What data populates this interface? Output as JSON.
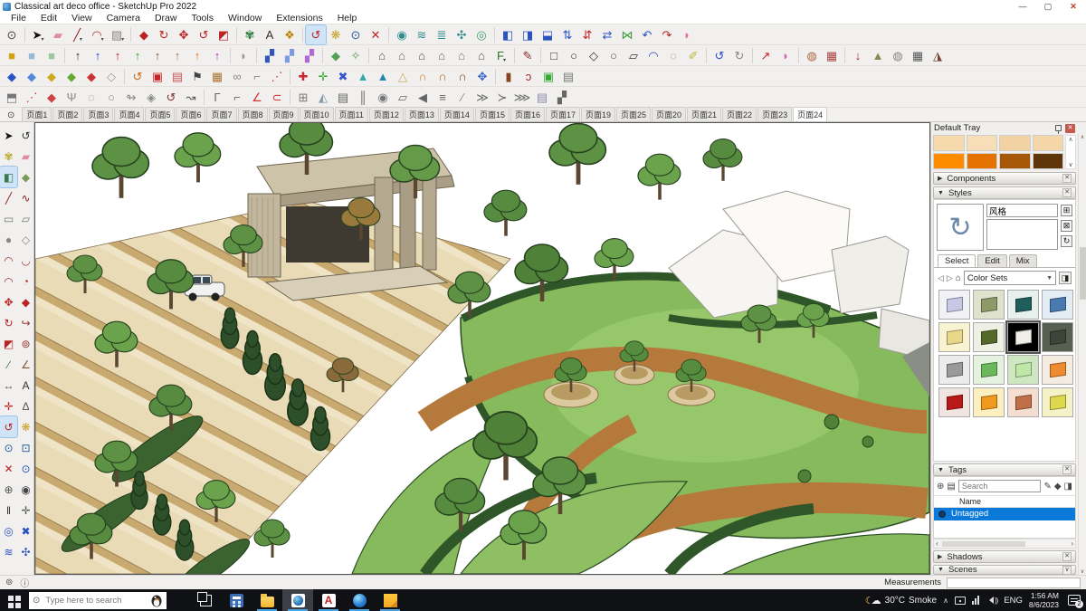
{
  "window": {
    "title": "Classical art deco office - SketchUp Pro 2022",
    "controls": {
      "minimize": "—",
      "maximize": "▢",
      "close": "✕"
    }
  },
  "menubar": [
    "File",
    "Edit",
    "View",
    "Camera",
    "Draw",
    "Tools",
    "Window",
    "Extensions",
    "Help"
  ],
  "toolbars": {
    "row1": [
      {
        "n": "zoom-tool",
        "g": "⊙",
        "c": "#444"
      },
      {
        "sep": 1
      },
      {
        "n": "select",
        "g": "➤",
        "c": "#111",
        "dd": 1
      },
      {
        "n": "eraser",
        "g": "▰",
        "c": "#e08ba0"
      },
      {
        "n": "line",
        "g": "╱",
        "c": "#8a1a1a",
        "dd": 1
      },
      {
        "n": "arc",
        "g": "◠",
        "c": "#a33",
        "dd": 1
      },
      {
        "n": "rectangle",
        "g": "▨",
        "c": "#8a8a8a",
        "dd": 1
      },
      {
        "sep": 1
      },
      {
        "n": "push-pull",
        "g": "◆",
        "c": "#b22"
      },
      {
        "n": "follow-me",
        "g": "↻",
        "c": "#b22"
      },
      {
        "n": "move",
        "g": "✥",
        "c": "#b22"
      },
      {
        "n": "rotate",
        "g": "↺",
        "c": "#b22"
      },
      {
        "n": "scale",
        "g": "◩",
        "c": "#b22"
      },
      {
        "sep": 1
      },
      {
        "n": "paint-bucket",
        "g": "✾",
        "c": "#2a7a3a"
      },
      {
        "n": "text",
        "g": "A",
        "c": "#333"
      },
      {
        "n": "match-photo",
        "g": "❖",
        "c": "#b8860b"
      },
      {
        "sep": 1
      },
      {
        "n": "orbit",
        "g": "↺",
        "c": "#b22",
        "sel": 1
      },
      {
        "n": "pan",
        "g": "❋",
        "c": "#c9a227"
      },
      {
        "n": "zoom",
        "g": "⊙",
        "c": "#235a9e"
      },
      {
        "n": "zoom-extents",
        "g": "✕",
        "c": "#b22"
      },
      {
        "sep": 1
      },
      {
        "n": "section-plane",
        "g": "◉",
        "c": "#2e8b8b"
      },
      {
        "n": "section-display",
        "g": "≋",
        "c": "#2e8b8b"
      },
      {
        "n": "section-cuts",
        "g": "≣",
        "c": "#2e8b8b"
      },
      {
        "n": "section-fill",
        "g": "✣",
        "c": "#2e8b8b"
      },
      {
        "n": "add-location",
        "g": "◎",
        "c": "#3aa06a"
      },
      {
        "sep": 1
      },
      {
        "n": "solid-union",
        "g": "◧",
        "c": "#2a52be"
      },
      {
        "n": "solid-subtract",
        "g": "◨",
        "c": "#2a52be"
      },
      {
        "n": "solid-trim",
        "g": "⬓",
        "c": "#2a52be"
      },
      {
        "n": "raise-object",
        "g": "⇅",
        "c": "#2a52be"
      },
      {
        "n": "drop-object",
        "g": "⇵",
        "c": "#b22"
      },
      {
        "n": "swap-axes",
        "g": "⇄",
        "c": "#2a52be"
      },
      {
        "n": "mirror",
        "g": "⋈",
        "c": "#3a9a3a"
      },
      {
        "n": "undo-curve",
        "g": "↶",
        "c": "#2a52be"
      },
      {
        "n": "redo-curve",
        "g": "↷",
        "c": "#b22"
      },
      {
        "n": "extrude-edges",
        "g": "◗",
        "c": "#e070a0"
      }
    ],
    "row2": [
      {
        "n": "box-ocher",
        "g": "■",
        "c": "#d4a017"
      },
      {
        "n": "box-blue",
        "g": "■",
        "c": "#9ab7d3"
      },
      {
        "n": "box-green",
        "g": "■",
        "c": "#9ec79e"
      },
      {
        "sep": 1
      },
      {
        "n": "drop-black",
        "g": "↑",
        "c": "#333"
      },
      {
        "n": "drop-blue",
        "g": "↑",
        "c": "#2244cc"
      },
      {
        "n": "drop-red",
        "g": "↑",
        "c": "#cc2222"
      },
      {
        "n": "drop-green",
        "g": "↑",
        "c": "#22aa22"
      },
      {
        "n": "drop-brown",
        "g": "↑",
        "c": "#775533"
      },
      {
        "n": "drop-tan",
        "g": "↑",
        "c": "#aa7744"
      },
      {
        "n": "drop-orange",
        "g": "↑",
        "c": "#dd7711"
      },
      {
        "n": "drop-magenta",
        "g": "↑",
        "c": "#cc22cc"
      },
      {
        "sep": 1
      },
      {
        "n": "shell",
        "g": "◗",
        "c": "#999"
      },
      {
        "sep": 1
      },
      {
        "n": "panel-1",
        "g": "▞",
        "c": "#3355bb"
      },
      {
        "n": "panel-2",
        "g": "▞",
        "c": "#7d9be0"
      },
      {
        "n": "panel-3",
        "g": "▞",
        "c": "#b06ad1"
      },
      {
        "sep": 1
      },
      {
        "n": "vegetation",
        "g": "◆",
        "c": "#55a055"
      },
      {
        "n": "skeleton",
        "g": "✧",
        "c": "#55a055"
      },
      {
        "sep": 1
      },
      {
        "n": "house-chimney",
        "g": "⌂",
        "c": "#555"
      },
      {
        "n": "house-tall",
        "g": "⌂",
        "c": "#666"
      },
      {
        "n": "house-plain",
        "g": "⌂",
        "c": "#555"
      },
      {
        "n": "house-flat",
        "g": "⌂",
        "c": "#666"
      },
      {
        "n": "house-outline",
        "g": "⌂",
        "c": "#777"
      },
      {
        "n": "house-roof",
        "g": "⌂",
        "c": "#555"
      },
      {
        "n": "fredo-scale",
        "g": "F",
        "c": "#2a7a2a",
        "dd": 1
      },
      {
        "sep": 1
      },
      {
        "n": "sketch-pencil",
        "g": "✎",
        "c": "#8a2a2a"
      },
      {
        "sep": 1
      },
      {
        "n": "shape-square",
        "g": "□",
        "c": "#333"
      },
      {
        "n": "shape-circle",
        "g": "○",
        "c": "#333"
      },
      {
        "n": "shape-polygon",
        "g": "◇",
        "c": "#333"
      },
      {
        "n": "shape-ellipse",
        "g": "○",
        "c": "#555"
      },
      {
        "n": "shape-parallelogram",
        "g": "▱",
        "c": "#333"
      },
      {
        "n": "shape-arc",
        "g": "◠",
        "c": "#2a52be"
      },
      {
        "n": "shape-ring",
        "g": "◌",
        "c": "#888"
      },
      {
        "n": "shape-marker",
        "g": "✐",
        "c": "#b8b83a"
      },
      {
        "sep": 1
      },
      {
        "n": "loop-blue",
        "g": "↺",
        "c": "#2a52be"
      },
      {
        "n": "loop-gray",
        "g": "↻",
        "c": "#888"
      },
      {
        "sep": 1
      },
      {
        "n": "vector-red",
        "g": "↗",
        "c": "#cc2222"
      },
      {
        "n": "vector-pink",
        "g": "◗",
        "c": "#dd66aa"
      },
      {
        "sep": 1
      },
      {
        "n": "mesh-dome",
        "g": "◍",
        "c": "#aa6644"
      },
      {
        "n": "mesh-grid",
        "g": "▦",
        "c": "#aa4444"
      },
      {
        "sep": 1
      },
      {
        "n": "stamp-down",
        "g": "↓",
        "c": "#aa2222"
      },
      {
        "n": "stamp-peak",
        "g": "▲",
        "c": "#888855"
      },
      {
        "n": "stamp-bag",
        "g": "◍",
        "c": "#888"
      },
      {
        "n": "stamp-dark",
        "g": "▦",
        "c": "#555"
      },
      {
        "n": "stamp-cone",
        "g": "◮",
        "c": "#774433"
      }
    ],
    "row3": [
      {
        "n": "gem-blue",
        "g": "◆",
        "c": "#2853c4"
      },
      {
        "n": "gem-skyblue",
        "g": "◆",
        "c": "#5588dd"
      },
      {
        "n": "gem-yellow",
        "g": "◆",
        "c": "#ccaa22"
      },
      {
        "n": "gem-green",
        "g": "◆",
        "c": "#66aa33"
      },
      {
        "n": "gem-red",
        "g": "◆",
        "c": "#cc3333"
      },
      {
        "n": "gem-outline",
        "g": "◇",
        "c": "#999"
      },
      {
        "sep": 1
      },
      {
        "n": "spiral-orange",
        "g": "↺",
        "c": "#cc6611"
      },
      {
        "n": "red-panel",
        "g": "▣",
        "c": "#cc2222"
      },
      {
        "n": "striped-panel",
        "g": "▤",
        "c": "#cc5555"
      },
      {
        "n": "flag",
        "g": "⚑",
        "c": "#444"
      },
      {
        "n": "wood-block",
        "g": "▦",
        "c": "#aa7733"
      },
      {
        "n": "link-pair",
        "g": "∞",
        "c": "#888"
      },
      {
        "n": "corner-tool",
        "g": "⌐",
        "c": "#888"
      },
      {
        "n": "path-dots",
        "g": "⋰",
        "c": "#cc3333"
      },
      {
        "sep": 1
      },
      {
        "n": "plus-red",
        "g": "✚",
        "c": "#cc2233"
      },
      {
        "n": "plus-green",
        "g": "✛",
        "c": "#33aa33"
      },
      {
        "n": "x-blue",
        "g": "✖",
        "c": "#3355cc"
      },
      {
        "n": "drop-teal",
        "g": "▲",
        "c": "#33aaaa"
      },
      {
        "n": "drop-teal-2",
        "g": "▲",
        "c": "#2288aa"
      },
      {
        "n": "cone-tan",
        "g": "△",
        "c": "#ccaa55"
      },
      {
        "n": "arch-orange",
        "g": "∩",
        "c": "#cc8833"
      },
      {
        "n": "arch-rust",
        "g": "∩",
        "c": "#aa6622"
      },
      {
        "n": "arch-brown",
        "g": "∩",
        "c": "#884411"
      },
      {
        "n": "compass-blue",
        "g": "✥",
        "c": "#3366cc"
      },
      {
        "sep": 1
      },
      {
        "n": "barrel",
        "g": "▮",
        "c": "#884422"
      },
      {
        "n": "hook-red",
        "g": "ↄ",
        "c": "#aa2222"
      },
      {
        "n": "green-board",
        "g": "▣",
        "c": "#33aa33"
      },
      {
        "n": "paste-board",
        "g": "▤",
        "c": "#777"
      }
    ],
    "row4": [
      {
        "n": "page-flip",
        "g": "⬒",
        "c": "#777"
      },
      {
        "n": "dots-path",
        "g": "⋰",
        "c": "#cc3333"
      },
      {
        "n": "claw",
        "g": "◆",
        "c": "#cc4444"
      },
      {
        "n": "fork",
        "g": "Ψ",
        "c": "#888"
      },
      {
        "n": "ring",
        "g": "◌",
        "c": "#888"
      },
      {
        "n": "blob",
        "g": "○",
        "c": "#888"
      },
      {
        "n": "swirl",
        "g": "↬",
        "c": "#888"
      },
      {
        "n": "gem-gray",
        "g": "◈",
        "c": "#888"
      },
      {
        "n": "knot",
        "g": "↺",
        "c": "#883333"
      },
      {
        "n": "lasso",
        "g": "↝",
        "c": "#555"
      },
      {
        "sep": 1
      },
      {
        "n": "corner-left",
        "g": "Γ",
        "c": "#666"
      },
      {
        "n": "corner-right",
        "g": "⌐",
        "c": "#666"
      },
      {
        "n": "angle-red",
        "g": "∠",
        "c": "#cc3333"
      },
      {
        "n": "curve-red",
        "g": "⊂",
        "c": "#cc3333"
      },
      {
        "sep": 1
      },
      {
        "n": "cage-grid",
        "g": "⊞",
        "c": "#777"
      },
      {
        "n": "prism",
        "g": "◭",
        "c": "#8899aa"
      },
      {
        "n": "louvers",
        "g": "▤",
        "c": "#666"
      },
      {
        "n": "fence",
        "g": "║",
        "c": "#666"
      },
      {
        "n": "grip",
        "g": "◉",
        "c": "#777"
      },
      {
        "n": "panel-flip",
        "g": "▱",
        "c": "#666"
      },
      {
        "n": "speaker-flag",
        "g": "◀",
        "c": "#666"
      },
      {
        "n": "list-lines",
        "g": "≡",
        "c": "#666"
      },
      {
        "n": "ramp",
        "g": "∕",
        "c": "#888"
      },
      {
        "n": "chevrons-1",
        "g": "≫",
        "c": "#666"
      },
      {
        "n": "chevrons-2",
        "g": "≻",
        "c": "#666"
      },
      {
        "n": "chevrons-3",
        "g": "⋙",
        "c": "#666"
      },
      {
        "n": "doc-gray",
        "g": "▤",
        "c": "#8888aa"
      },
      {
        "n": "hatch",
        "g": "▞",
        "c": "#666"
      }
    ]
  },
  "scene_tabs": {
    "search_icon": "⊙",
    "labels": [
      "页面1",
      "页面2",
      "页面3",
      "页面4",
      "页面5",
      "页面6",
      "页面7",
      "页面8",
      "页面9",
      "页面10",
      "页面11",
      "页面12",
      "页面13",
      "页面14",
      "页面15",
      "页面16",
      "页面17",
      "页面19",
      "页面25",
      "页面20",
      "页面21",
      "页面22",
      "页面23",
      "页面24"
    ],
    "selected_index": 23
  },
  "left_toolbar": [
    {
      "n": "select",
      "g": "➤",
      "c": "#111"
    },
    {
      "n": "orbit-select",
      "g": "↺",
      "c": "#333"
    },
    {
      "n": "paint",
      "g": "✾",
      "c": "#b8a832"
    },
    {
      "n": "eraser",
      "g": "▰",
      "c": "#e08ba0"
    },
    {
      "n": "component-box",
      "g": "◧",
      "c": "#3a7a4a",
      "sel": 1
    },
    {
      "n": "stamp",
      "g": "◆",
      "c": "#7a9a5a"
    },
    {
      "n": "line",
      "g": "╱",
      "c": "#8a1a1a"
    },
    {
      "n": "freehand",
      "g": "∿",
      "c": "#8a1a1a"
    },
    {
      "n": "rectangle",
      "g": "▭",
      "c": "#777"
    },
    {
      "n": "rotated-rectangle",
      "g": "▱",
      "c": "#777"
    },
    {
      "n": "circle",
      "g": "●",
      "c": "#888"
    },
    {
      "n": "polygon",
      "g": "◇",
      "c": "#888"
    },
    {
      "n": "arc",
      "g": "◠",
      "c": "#a33"
    },
    {
      "n": "two-point-arc",
      "g": "◡",
      "c": "#a33"
    },
    {
      "n": "three-point-arc",
      "g": "◠",
      "c": "#933"
    },
    {
      "n": "pie",
      "g": "◔",
      "c": "#a33"
    },
    {
      "n": "move",
      "g": "✥",
      "c": "#b22"
    },
    {
      "n": "push-pull",
      "g": "◆",
      "c": "#b22"
    },
    {
      "n": "rotate",
      "g": "↻",
      "c": "#b22"
    },
    {
      "n": "follow-me",
      "g": "↪",
      "c": "#933"
    },
    {
      "n": "scale",
      "g": "◩",
      "c": "#b22"
    },
    {
      "n": "offset",
      "g": "⊚",
      "c": "#933"
    },
    {
      "n": "tape-measure",
      "g": "∕",
      "c": "#2a7a3a"
    },
    {
      "n": "protractor",
      "g": "∠",
      "c": "#885533"
    },
    {
      "n": "dimension",
      "g": "↔",
      "c": "#555"
    },
    {
      "n": "text",
      "g": "A",
      "c": "#333"
    },
    {
      "n": "axes",
      "g": "✛",
      "c": "#b22"
    },
    {
      "n": "three-d-text",
      "g": "Δ",
      "c": "#555"
    },
    {
      "n": "orbit",
      "g": "↺",
      "c": "#b22",
      "sel": 1
    },
    {
      "n": "pan",
      "g": "❋",
      "c": "#c9a227"
    },
    {
      "n": "zoom",
      "g": "⊙",
      "c": "#235a9e"
    },
    {
      "n": "zoom-window",
      "g": "⊡",
      "c": "#235a9e"
    },
    {
      "n": "zoom-extents",
      "g": "✕",
      "c": "#b22"
    },
    {
      "n": "zoom-previous",
      "g": "⊙",
      "c": "#2a52be"
    },
    {
      "n": "position-camera",
      "g": "⊕",
      "c": "#555"
    },
    {
      "n": "look-around",
      "g": "◉",
      "c": "#444"
    },
    {
      "n": "walk",
      "g": "‖",
      "c": "#333"
    },
    {
      "n": "turn-target",
      "g": "✛",
      "c": "#555"
    },
    {
      "n": "section-plane",
      "g": "◎",
      "c": "#2a52be"
    },
    {
      "n": "section-x",
      "g": "✖",
      "c": "#2a52be"
    },
    {
      "n": "section-fill",
      "g": "≋",
      "c": "#2a52be"
    },
    {
      "n": "section-cut",
      "g": "✣",
      "c": "#2a52be"
    }
  ],
  "tray": {
    "title": "Default Tray",
    "palette": {
      "row1": [
        "#f6d9ad",
        "#f8deb6",
        "#f3d2a2",
        "#f5d6a8"
      ],
      "row2": [
        "#ff8c00",
        "#e37200",
        "#a65708",
        "#5e3509"
      ]
    },
    "sections": {
      "components": "Components",
      "styles": "Styles",
      "tags": "Tags",
      "shadows": "Shadows",
      "scenes": "Scenes"
    },
    "styles": {
      "name_value": "风格",
      "preview_glyph": "↻",
      "tabs": [
        "Select",
        "Edit",
        "Mix"
      ],
      "active_tab": "Select",
      "collection": "Color Sets",
      "thumbs": [
        {
          "bg": "#f2f2f5",
          "cube": "#c8c8e6"
        },
        {
          "bg": "#dfe3cd",
          "cube": "#8f9a6a"
        },
        {
          "bg": "#e8f0ee",
          "cube": "#1f5f5b"
        },
        {
          "bg": "#e4ecf4",
          "cube": "#4a7ab0"
        },
        {
          "bg": "#faf3d2",
          "cube": "#e8d98a"
        },
        {
          "bg": "#eef0e4",
          "cube": "#55682c"
        },
        {
          "bg": "#000000",
          "cube": "#f0f0e8",
          "sel": 1
        },
        {
          "bg": "#565f50",
          "cube": "#3c453a"
        },
        {
          "bg": "#ececec",
          "cube": "#9a9a9a"
        },
        {
          "bg": "#e6f2e0",
          "cube": "#6cb85c"
        },
        {
          "bg": "#cfe6c2",
          "cube": "#bfe8a8"
        },
        {
          "bg": "#f4ece0",
          "cube": "#ee8a30"
        },
        {
          "bg": "#f0e4e0",
          "cube": "#b81818"
        },
        {
          "bg": "#fdf0c0",
          "cube": "#f09a20"
        },
        {
          "bg": "#f4ded2",
          "cube": "#c07048"
        },
        {
          "bg": "#f6f2c8",
          "cube": "#ddd84e"
        }
      ]
    },
    "tags": {
      "search_placeholder": "Search",
      "name_header": "Name",
      "rows": [
        {
          "label": "Untagged",
          "selected": true
        }
      ]
    }
  },
  "status_bar": {
    "geo_icon": "⊚",
    "credits_icon": "ⓘ",
    "measurements_label": "Measurements"
  },
  "taskbar": {
    "search_placeholder": "Type here to search",
    "weather_temp": "30°C",
    "weather_desc": "Smoke",
    "hidden_icons": "∧",
    "language": "ENG",
    "time": "1:56 AM",
    "date": "8/6/2023",
    "notifications_count": "2",
    "apps": [
      {
        "n": "task-view"
      },
      {
        "n": "calculator"
      },
      {
        "n": "file-explorer",
        "run": 1
      },
      {
        "n": "sketchup",
        "run": 1,
        "active": 1
      },
      {
        "n": "acrobat",
        "run": 1
      },
      {
        "n": "edge",
        "run": 1
      },
      {
        "n": "sticky-notes",
        "run": 1
      }
    ]
  },
  "colors": {
    "selection_blue": "#0b79d7",
    "taskbar_bg": "#101114",
    "tool_active_bg": "#cfe4f7",
    "tray_bg": "#f0efed",
    "grass_green": "#86ba5c",
    "hedge_green": "#2e5629",
    "path_terracotta": "#b5793c",
    "pavement_tan": "#e8dbb6"
  }
}
